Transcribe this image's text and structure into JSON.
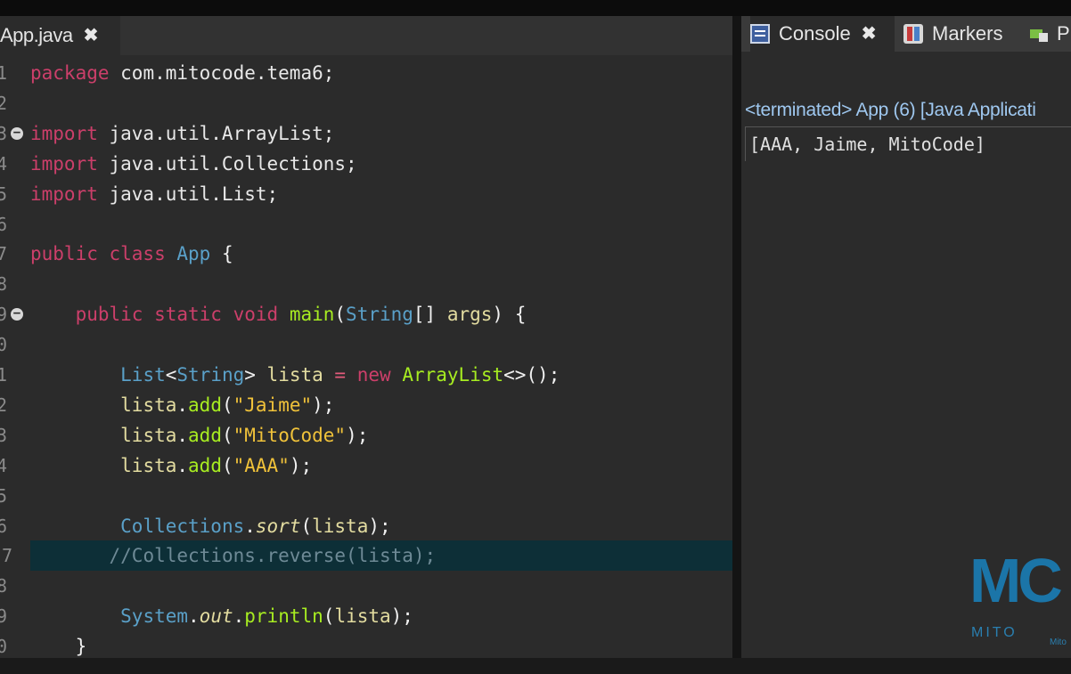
{
  "editor": {
    "tab_label": "App.java",
    "tab_close": "✖",
    "lines": [
      {
        "num": "1",
        "segments": [
          {
            "t": "package",
            "c": "kw"
          },
          {
            "t": " com.mitocode.tema6;",
            "c": "plain"
          }
        ]
      },
      {
        "num": "2",
        "segments": []
      },
      {
        "num": "3",
        "fold": true,
        "segments": [
          {
            "t": "import",
            "c": "kw"
          },
          {
            "t": " java.util.ArrayList;",
            "c": "plain"
          }
        ]
      },
      {
        "num": "4",
        "segments": [
          {
            "t": "import",
            "c": "kw"
          },
          {
            "t": " java.util.Collections;",
            "c": "plain"
          }
        ]
      },
      {
        "num": "5",
        "segments": [
          {
            "t": "import",
            "c": "kw"
          },
          {
            "t": " java.util.List;",
            "c": "plain"
          }
        ]
      },
      {
        "num": "6",
        "segments": []
      },
      {
        "num": "7",
        "segments": [
          {
            "t": "public class",
            "c": "kw"
          },
          {
            "t": " ",
            "c": "plain"
          },
          {
            "t": "App",
            "c": "cls"
          },
          {
            "t": " {",
            "c": "pun"
          }
        ]
      },
      {
        "num": "8",
        "segments": []
      },
      {
        "num": "9",
        "fold": true,
        "segments": [
          {
            "t": "    ",
            "c": "plain"
          },
          {
            "t": "public static void",
            "c": "kw"
          },
          {
            "t": " ",
            "c": "plain"
          },
          {
            "t": "main",
            "c": "fn"
          },
          {
            "t": "(",
            "c": "pun"
          },
          {
            "t": "String",
            "c": "cls"
          },
          {
            "t": "[] ",
            "c": "pun"
          },
          {
            "t": "args",
            "c": "var"
          },
          {
            "t": ") {",
            "c": "pun"
          }
        ]
      },
      {
        "num": "0",
        "segments": []
      },
      {
        "num": "1",
        "segments": [
          {
            "t": "        ",
            "c": "plain"
          },
          {
            "t": "List",
            "c": "cls"
          },
          {
            "t": "<",
            "c": "pun"
          },
          {
            "t": "String",
            "c": "cls"
          },
          {
            "t": "> ",
            "c": "pun"
          },
          {
            "t": "lista",
            "c": "var"
          },
          {
            "t": " ",
            "c": "plain"
          },
          {
            "t": "=",
            "c": "op"
          },
          {
            "t": " ",
            "c": "plain"
          },
          {
            "t": "new",
            "c": "kw"
          },
          {
            "t": " ",
            "c": "plain"
          },
          {
            "t": "ArrayList",
            "c": "fn"
          },
          {
            "t": "<>();",
            "c": "pun"
          }
        ]
      },
      {
        "num": "2",
        "segments": [
          {
            "t": "        ",
            "c": "plain"
          },
          {
            "t": "lista",
            "c": "var"
          },
          {
            "t": ".",
            "c": "pun"
          },
          {
            "t": "add",
            "c": "fn"
          },
          {
            "t": "(",
            "c": "pun"
          },
          {
            "t": "\"Jaime\"",
            "c": "str"
          },
          {
            "t": ");",
            "c": "pun"
          }
        ]
      },
      {
        "num": "3",
        "segments": [
          {
            "t": "        ",
            "c": "plain"
          },
          {
            "t": "lista",
            "c": "var"
          },
          {
            "t": ".",
            "c": "pun"
          },
          {
            "t": "add",
            "c": "fn"
          },
          {
            "t": "(",
            "c": "pun"
          },
          {
            "t": "\"MitoCode\"",
            "c": "str"
          },
          {
            "t": ");",
            "c": "pun"
          }
        ]
      },
      {
        "num": "4",
        "segments": [
          {
            "t": "        ",
            "c": "plain"
          },
          {
            "t": "lista",
            "c": "var"
          },
          {
            "t": ".",
            "c": "pun"
          },
          {
            "t": "add",
            "c": "fn"
          },
          {
            "t": "(",
            "c": "pun"
          },
          {
            "t": "\"AAA\"",
            "c": "str"
          },
          {
            "t": ");",
            "c": "pun"
          }
        ]
      },
      {
        "num": "5",
        "segments": []
      },
      {
        "num": "6",
        "segments": [
          {
            "t": "        ",
            "c": "plain"
          },
          {
            "t": "Collections",
            "c": "cls"
          },
          {
            "t": ".",
            "c": "pun"
          },
          {
            "t": "sort",
            "c": "var it"
          },
          {
            "t": "(",
            "c": "pun"
          },
          {
            "t": "lista",
            "c": "var"
          },
          {
            "t": ");",
            "c": "pun"
          }
        ]
      },
      {
        "num": "7",
        "current": true,
        "segments": [
          {
            "t": "       ",
            "c": "plain"
          },
          {
            "t": "//Collections.reverse(lista);",
            "c": "cmt"
          }
        ]
      },
      {
        "num": "8",
        "segments": []
      },
      {
        "num": "9",
        "segments": [
          {
            "t": "        ",
            "c": "plain"
          },
          {
            "t": "System",
            "c": "cls"
          },
          {
            "t": ".",
            "c": "pun"
          },
          {
            "t": "out",
            "c": "var it"
          },
          {
            "t": ".",
            "c": "pun"
          },
          {
            "t": "println",
            "c": "fn"
          },
          {
            "t": "(",
            "c": "pun"
          },
          {
            "t": "lista",
            "c": "var"
          },
          {
            "t": ");",
            "c": "pun"
          }
        ]
      },
      {
        "num": "0",
        "segments": [
          {
            "t": "    }",
            "c": "pun"
          }
        ]
      }
    ]
  },
  "console": {
    "tabs": [
      {
        "label": "Console",
        "icon": "console-icon",
        "close": "✖"
      },
      {
        "label": "Markers",
        "icon": "markers-icon"
      },
      {
        "label": "Pr",
        "icon": "properties-icon"
      }
    ],
    "status": "<terminated> App (6) [Java Applicati",
    "output": "[AAA, Jaime, MitoCode]"
  },
  "logo": {
    "letters": "MC",
    "name": "MITO",
    "small": "Mito"
  },
  "colors": {
    "keyword": "#cc3f6a",
    "class": "#5aa0c8",
    "method": "#a7ec21",
    "string": "#f0c23a",
    "current_line": "#0d2f37",
    "background": "#2b2b2b"
  }
}
